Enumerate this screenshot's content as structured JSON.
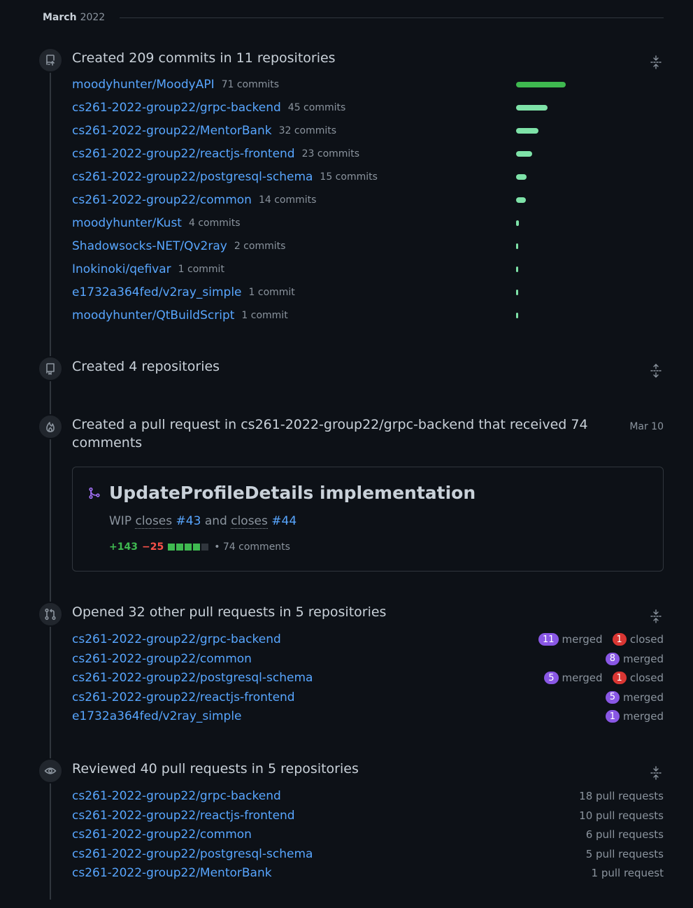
{
  "month": {
    "name": "March",
    "year": "2022"
  },
  "commits": {
    "title": "Created 209 commits in 11 repositories",
    "icon": "repo-push-icon",
    "repos": [
      {
        "name": "moodyhunter/MoodyAPI",
        "count": "71 commits",
        "value": 71
      },
      {
        "name": "cs261-2022-group22/grpc-backend",
        "count": "45 commits",
        "value": 45
      },
      {
        "name": "cs261-2022-group22/MentorBank",
        "count": "32 commits",
        "value": 32
      },
      {
        "name": "cs261-2022-group22/reactjs-frontend",
        "count": "23 commits",
        "value": 23
      },
      {
        "name": "cs261-2022-group22/postgresql-schema",
        "count": "15 commits",
        "value": 15
      },
      {
        "name": "cs261-2022-group22/common",
        "count": "14 commits",
        "value": 14
      },
      {
        "name": "moodyhunter/Kust",
        "count": "4 commits",
        "value": 4
      },
      {
        "name": "Shadowsocks-NET/Qv2ray",
        "count": "2 commits",
        "value": 2
      },
      {
        "name": "Inokinoki/qefivar",
        "count": "1 commit",
        "value": 1
      },
      {
        "name": "e1732a364fed/v2ray_simple",
        "count": "1 commit",
        "value": 1
      },
      {
        "name": "moodyhunter/QtBuildScript",
        "count": "1 commit",
        "value": 1
      }
    ],
    "bar_colors": {
      "primary": "#3fb950",
      "secondary": "#7ee2a8"
    }
  },
  "repos_created": {
    "title": "Created 4 repositories",
    "icon": "repo-icon"
  },
  "pull_request": {
    "title_line1": "Created a pull request in cs261-2022-group22/grpc-backend that received 74",
    "title_line2": "comments",
    "date": "Mar 10",
    "icon": "flame-icon",
    "card": {
      "title": "UpdateProfileDetails implementation",
      "body_prefix": "WIP ",
      "closes1": "closes",
      "ref1": "#43",
      "and": " and ",
      "closes2": "closes",
      "ref2": "#44",
      "additions": "+143",
      "deletions": "−25",
      "diff_blocks": [
        "#3fb950",
        "#3fb950",
        "#3fb950",
        "#3fb950",
        "#30363d"
      ],
      "comments": "• 74 comments"
    }
  },
  "opened_prs": {
    "title": "Opened 32 other pull requests in 5 repositories",
    "icon": "git-pull-request-icon",
    "merged_label": "merged",
    "closed_label": "closed",
    "repos": [
      {
        "name": "cs261-2022-group22/grpc-backend",
        "merged": "11",
        "closed": "1"
      },
      {
        "name": "cs261-2022-group22/common",
        "merged": "8",
        "closed": null
      },
      {
        "name": "cs261-2022-group22/postgresql-schema",
        "merged": "5",
        "closed": "1"
      },
      {
        "name": "cs261-2022-group22/reactjs-frontend",
        "merged": "5",
        "closed": null
      },
      {
        "name": "e1732a364fed/v2ray_simple",
        "merged": "1",
        "closed": null
      }
    ]
  },
  "reviewed_prs": {
    "title": "Reviewed 40 pull requests in 5 repositories",
    "icon": "eye-icon",
    "repos": [
      {
        "name": "cs261-2022-group22/grpc-backend",
        "count": "18 pull requests"
      },
      {
        "name": "cs261-2022-group22/reactjs-frontend",
        "count": "10 pull requests"
      },
      {
        "name": "cs261-2022-group22/common",
        "count": "6 pull requests"
      },
      {
        "name": "cs261-2022-group22/postgresql-schema",
        "count": "5 pull requests"
      },
      {
        "name": "cs261-2022-group22/MentorBank",
        "count": "1 pull request"
      }
    ]
  }
}
